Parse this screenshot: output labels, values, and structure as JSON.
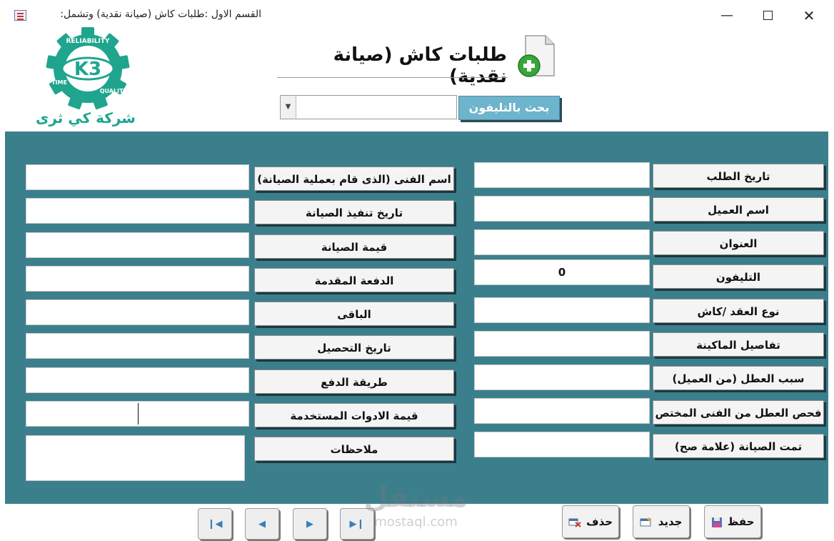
{
  "window": {
    "title": "القسم الاول :طلبات كاش (صيانة نقدية) وتشمل:"
  },
  "header": {
    "company_name": "شركة كي ثرى",
    "logo_text": "K3",
    "logo_ring_top": "RELIABILITY",
    "logo_ring_left": "TIME",
    "logo_ring_right": "QUALITY",
    "form_title": "طلبات كاش (صيانة نقدية)",
    "search_button": "بحث بالتليفون",
    "search_value": ""
  },
  "right_fields": [
    {
      "label": "تاريخ الطلب",
      "value": ""
    },
    {
      "label": "اسم العميل",
      "value": ""
    },
    {
      "label": "العنوان",
      "value": ""
    },
    {
      "label": "التليفون",
      "value": "0"
    },
    {
      "label": "نوع العقد /كاش",
      "value": ""
    },
    {
      "label": "تفاصيل الماكينة",
      "value": ""
    },
    {
      "label": "سبب العطل (من العميل)",
      "value": ""
    },
    {
      "label": "فحص العطل من الفنى المختص",
      "value": ""
    },
    {
      "label": "تمت الصيانة (علامة صح)",
      "value": ""
    }
  ],
  "left_fields": [
    {
      "label": "اسم الفنى (الذى قام بعملية الصيانة)",
      "value": ""
    },
    {
      "label": "تاريخ تنفيذ الصيانة",
      "value": ""
    },
    {
      "label": "قيمة الصيانة",
      "value": ""
    },
    {
      "label": "الدفعة المقدمة",
      "value": ""
    },
    {
      "label": "الباقى",
      "value": ""
    },
    {
      "label": "تاريخ التحصيل",
      "value": ""
    },
    {
      "label": "طريقة الدفع",
      "value": ""
    },
    {
      "label": "قيمة الادوات المستخدمة",
      "value": ""
    },
    {
      "label": "ملاحظات",
      "value": ""
    }
  ],
  "footer": {
    "delete_label": "حذف",
    "new_label": "جديد",
    "save_label": "حفظ"
  },
  "watermark": {
    "arabic": "مستقل",
    "latin": "mostaql.com"
  },
  "colors": {
    "detail_bg": "#3b7f8c",
    "search_button_bg": "#6eb4cc",
    "logo_green": "#1fa58e"
  }
}
